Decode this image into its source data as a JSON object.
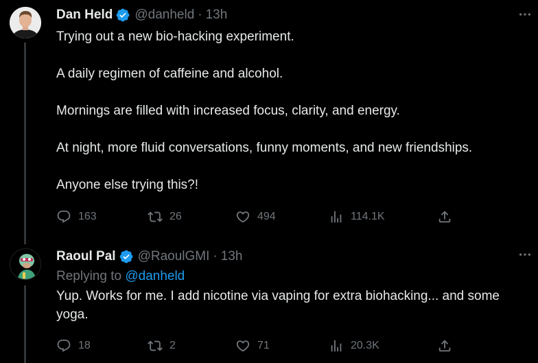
{
  "tweets": [
    {
      "name": "Dan Held",
      "handle": "@danheld",
      "separator": "·",
      "time": "13h",
      "paragraphs": [
        "Trying out a new bio-hacking experiment.",
        "A daily regimen of caffeine and alcohol.",
        "Mornings are filled with increased focus, clarity, and energy.",
        "At night, more fluid conversations, funny moments, and new friendships.",
        "Anyone else trying this?!"
      ],
      "stats": {
        "replies": "163",
        "retweets": "26",
        "likes": "494",
        "views": "114.1K"
      }
    },
    {
      "name": "Raoul Pal",
      "handle": "@RaoulGMI",
      "separator": "·",
      "time": "13h",
      "replying_prefix": "Replying to",
      "replying_to": "@danheld",
      "text": "Yup. Works for me. I add nicotine via vaping for extra biohacking... and some yoga.",
      "stats": {
        "replies": "18",
        "retweets": "2",
        "likes": "71",
        "views": "20.3K"
      }
    }
  ],
  "colors": {
    "background": "#000000",
    "text": "#e7e9ea",
    "muted": "#71767b",
    "link": "#1d9bf0",
    "verified": "#1d9bf0"
  },
  "icons": [
    "more-icon",
    "verified-icon",
    "reply-icon",
    "retweet-icon",
    "like-icon",
    "views-icon",
    "share-icon"
  ]
}
